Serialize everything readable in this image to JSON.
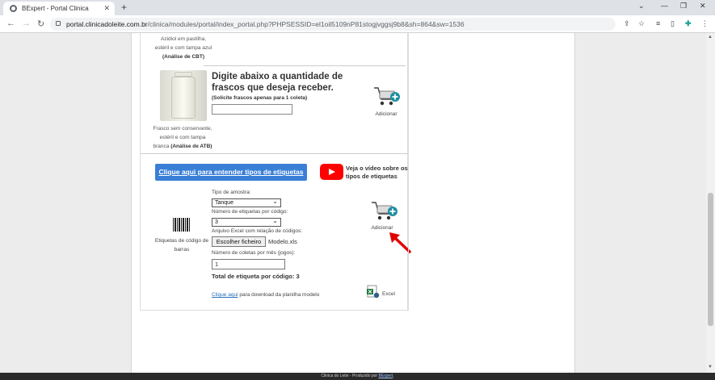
{
  "browser": {
    "tab_title": "BExpert - Portal Clinica",
    "tab_close": "✕",
    "new_tab": "+",
    "url_main": "portal.clinicadoleite.com.br",
    "url_rest": "/clinica/modules/portal/index_portal.php?PHPSESSID=el1oil5109nP81stogjvggsj9b8&sh=864&sw=1536"
  },
  "section1": {
    "caption_top_line1": "Azidiol em pastilha,",
    "caption_top_line2": "estéril e com tampa azul",
    "caption_top_line3": "(Análise de CBT)",
    "heading": "Digite abaixo a quantidade de frascos que deseja receber.",
    "note": "(Solicite frascos apenas para 1 coleta)",
    "quantity_value": "",
    "bottle_caption_line1": "Frasco sem conservante,",
    "bottle_caption_line2": "estéril e com tampa",
    "bottle_caption_line3a": "branca",
    "bottle_caption_line3b": "(Análise de ATB)",
    "add_label": "Adicionar"
  },
  "section2": {
    "help_button": "Clique aqui para entender tipos de etiquetas",
    "video_text": "Veja o vídeo sobre os tipos de etiquetas",
    "barcode_label": "Etiquetas de código de barras",
    "sample_type_label": "Tipo de amostra:",
    "sample_type_value": "Tanque",
    "labels_per_code_label": "Número de etiquetas por código:",
    "labels_per_code_value": "3",
    "excel_file_label": "Arquivo Excel com relação de códigos:",
    "choose_file_button": "Escolher ficheiro",
    "file_name": "Modelo.xls",
    "collections_label": "Número de coletas por mês (jogos):",
    "collections_value": "1",
    "total_text": "Total de etiqueta por código: 3",
    "download_link": "Clique aqui",
    "download_text": " para download da planilha modelo",
    "excel_label": "Excel",
    "add_label": "Adicionar"
  },
  "footer": {
    "text": "Clinica do Leite - Produzido por ",
    "link": "BExpert",
    "suffix": "."
  },
  "colors": {
    "button_blue": "#3a7fd6",
    "youtube_red": "#ff0000",
    "arrow_red": "#e00000"
  }
}
